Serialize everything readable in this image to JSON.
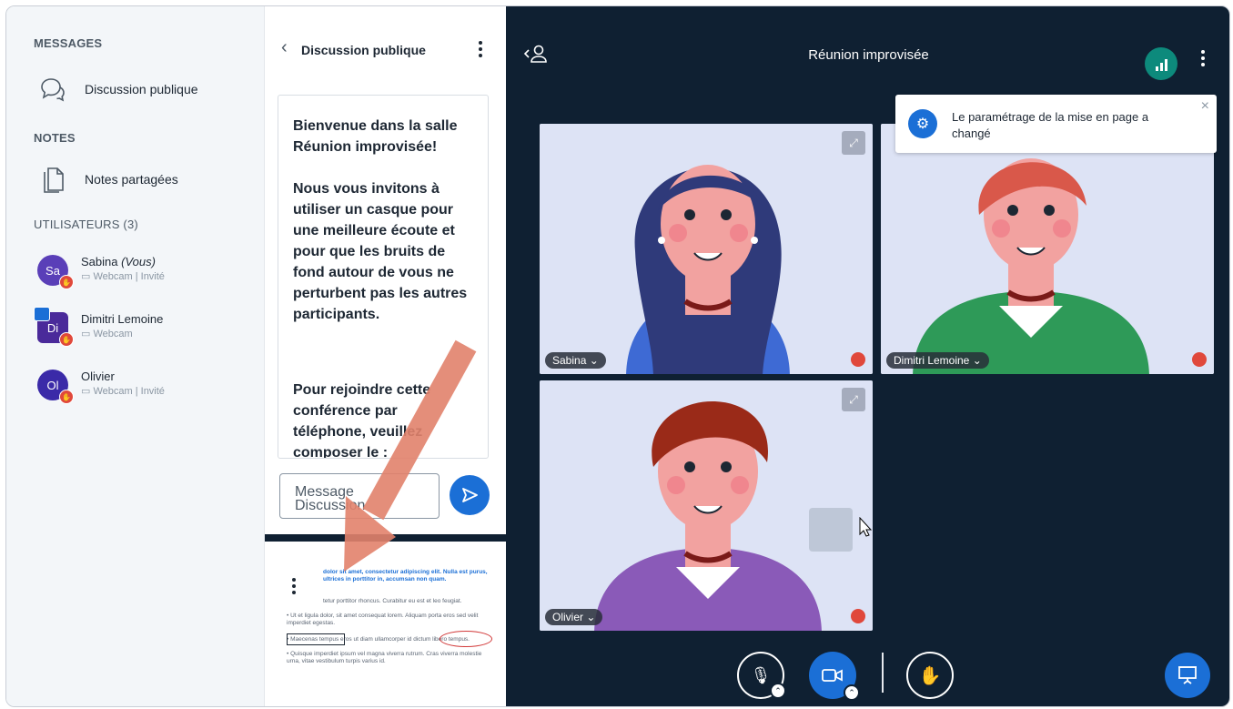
{
  "sidebar": {
    "messages_title": "MESSAGES",
    "public_chat_label": "Discussion publique",
    "notes_title": "NOTES",
    "shared_notes_label": "Notes partagées",
    "users_title": "UTILISATEURS (3)",
    "users": [
      {
        "initials": "Sa",
        "name": "Sabina",
        "you": "(Vous)",
        "role": "Webcam | Invité",
        "color": "#5a3fb8"
      },
      {
        "initials": "Di",
        "name": "Dimitri Lemoine",
        "you": "",
        "role": "Webcam",
        "color": "#5a3fb8"
      },
      {
        "initials": "Ol",
        "name": "Olivier",
        "you": "",
        "role": "Webcam | Invité",
        "color": "#5a3fb8"
      }
    ]
  },
  "chat": {
    "title": "Discussion publique",
    "welcome_1": "Bienvenue dans la salle Réunion improvisée!",
    "welcome_2": "Nous vous invitons à utiliser un casque pour une meilleure écoute et pour que les bruits de fond autour de vous ne perturbent pas les autres participants.",
    "welcome_3": "Pour rejoindre cette conférence par téléphone, veuillez composer le :",
    "input_placeholder": "Message Discussion"
  },
  "thumb": {
    "line1": "dolor sit amet, consectetur adipiscing elit. Nulla est purus, ultrices in porttitor in, accumsan non quam.",
    "line2": "tetur porttitor rhoncus. Curabitur eu est et leo feugiat.",
    "bullet1": "Ut et ligula dolor, sit amet consequat lorem. Aliquam porta eros sed velit imperdiet egestas.",
    "bullet2": "Maecenas tempus eros ut diam ullamcorper id dictum libero tempus.",
    "bullet3": "Quisque imperdiet ipsum vel magna viverra rutrum. Cras viverra molestie urna, vitae vestibulum turpis varius id."
  },
  "main": {
    "meeting_title": "Réunion improvisée",
    "notification": "Le paramétrage de la mise en page a changé",
    "tiles": [
      {
        "name": "Sabina",
        "hair": "#2f3a7a",
        "shirt": "#3e6ad4"
      },
      {
        "name": "Dimitri Lemoine",
        "hair": "#d9584a",
        "shirt": "#2e9a58"
      },
      {
        "name": "Olivier",
        "hair": "#9a2a18",
        "shirt": "#8a5ab8"
      }
    ]
  },
  "colors": {
    "accent": "#1b6fd6",
    "bg_dark": "#0f2032",
    "alert_red": "#e0483b",
    "connection": "#0d8a7c"
  }
}
